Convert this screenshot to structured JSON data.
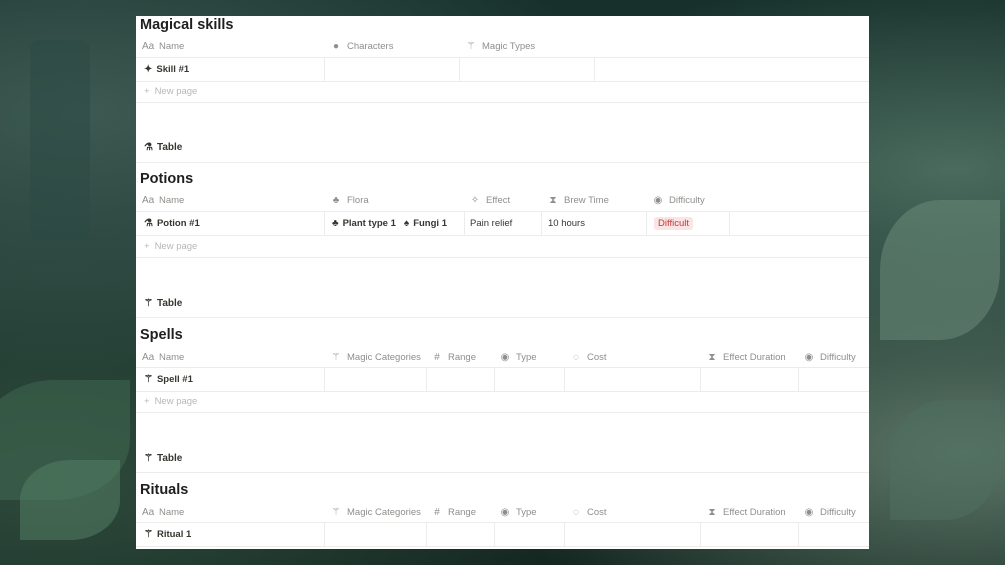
{
  "skills": {
    "title": "Magical skills",
    "headers": {
      "name": "Name",
      "characters": "Characters",
      "magic_types": "Magic Types"
    },
    "row": {
      "name": "Skill #1"
    },
    "new_page": "New page"
  },
  "potions": {
    "view_tab": "Table",
    "title": "Potions",
    "headers": {
      "name": "Name",
      "flora": "Flora",
      "effect": "Effect",
      "brew_time": "Brew Time",
      "difficulty": "Difficulty"
    },
    "row": {
      "name": "Potion #1",
      "flora_1": "Plant type 1",
      "flora_2": "Fungi 1",
      "effect": "Pain relief",
      "brew_time": "10 hours",
      "difficulty": "Difficult"
    },
    "new_page": "New page"
  },
  "spells": {
    "view_tab": "Table",
    "title": "Spells",
    "headers": {
      "name": "Name",
      "magic_categories": "Magic Categories",
      "range": "Range",
      "type": "Type",
      "cost": "Cost",
      "effect_duration": "Effect Duration",
      "difficulty": "Difficulty"
    },
    "row": {
      "name": "Spell #1"
    },
    "new_page": "New page"
  },
  "rituals": {
    "view_tab": "Table",
    "title": "Rituals",
    "headers": {
      "name": "Name",
      "magic_categories": "Magic Categories",
      "range": "Range",
      "type": "Type",
      "cost": "Cost",
      "effect_duration": "Effect Duration",
      "difficulty": "Difficulty"
    },
    "row": {
      "name": "Ritual 1"
    }
  },
  "icons": {
    "name_prefix": "Aa",
    "person": "person-circle-icon",
    "wand": "magic-wand-icon",
    "flask": "flask-icon",
    "plant": "plant-icon",
    "mushroom": "mushroom-icon",
    "sparkle": "sparkle-icon",
    "hourglass": "hourglass-icon",
    "circle_chevron": "circle-chevron-icon",
    "hash": "hash-icon",
    "loader": "dotted-circle-icon",
    "plus": "plus-icon"
  },
  "colors": {
    "difficult_tag_bg": "#fbe4e4",
    "difficult_tag_text": "#c23a3a",
    "header_text": "#8f8e8b",
    "grid_line": "#ececeb"
  }
}
